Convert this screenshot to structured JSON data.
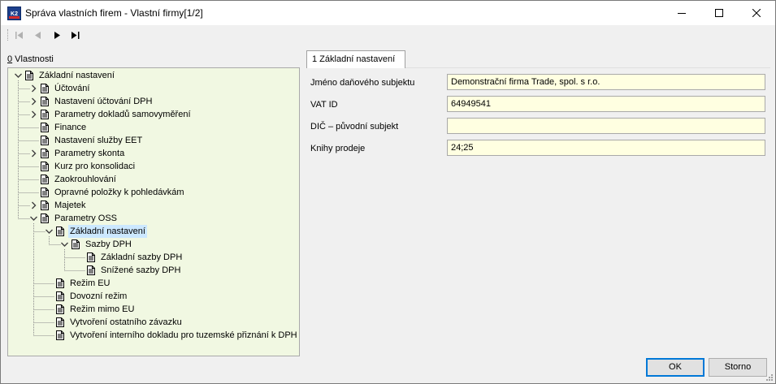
{
  "window": {
    "title": "Správa vlastních firem - Vlastní firmy[1/2]",
    "app_icon_text": "K2"
  },
  "toolbar": {
    "buttons": [
      "first-record",
      "previous-record",
      "next-record",
      "last-record"
    ]
  },
  "left_panel": {
    "label_hotkey": "0",
    "label_rest": " Vlastnosti"
  },
  "tree": {
    "items": [
      {
        "label": "Základní nastavení",
        "level": 0,
        "expander": "expanded",
        "selected": false
      },
      {
        "label": "Účtování",
        "level": 1,
        "expander": "collapsed",
        "selected": false
      },
      {
        "label": "Nastavení účtování DPH",
        "level": 1,
        "expander": "collapsed",
        "selected": false
      },
      {
        "label": "Parametry dokladů samovyměření",
        "level": 1,
        "expander": "collapsed",
        "selected": false
      },
      {
        "label": "Finance",
        "level": 1,
        "expander": "none",
        "selected": false
      },
      {
        "label": "Nastavení služby EET",
        "level": 1,
        "expander": "none",
        "selected": false
      },
      {
        "label": "Parametry skonta",
        "level": 1,
        "expander": "collapsed",
        "selected": false
      },
      {
        "label": "Kurz pro konsolidaci",
        "level": 1,
        "expander": "none",
        "selected": false
      },
      {
        "label": "Zaokrouhlování",
        "level": 1,
        "expander": "none",
        "selected": false
      },
      {
        "label": "Opravné položky k pohledávkám",
        "level": 1,
        "expander": "none",
        "selected": false
      },
      {
        "label": "Majetek",
        "level": 1,
        "expander": "collapsed",
        "selected": false
      },
      {
        "label": "Parametry OSS",
        "level": 1,
        "expander": "expanded",
        "selected": false
      },
      {
        "label": "Základní nastavení",
        "level": 2,
        "expander": "expanded",
        "selected": true
      },
      {
        "label": "Sazby DPH",
        "level": 3,
        "expander": "expanded",
        "selected": false
      },
      {
        "label": "Základní sazby DPH",
        "level": 4,
        "expander": "none",
        "selected": false
      },
      {
        "label": "Snížené sazby DPH",
        "level": 4,
        "expander": "none",
        "selected": false
      },
      {
        "label": "Režim EU",
        "level": 2,
        "expander": "none",
        "selected": false
      },
      {
        "label": "Dovozní režim",
        "level": 2,
        "expander": "none",
        "selected": false
      },
      {
        "label": "Režim mimo EU",
        "level": 2,
        "expander": "none",
        "selected": false
      },
      {
        "label": "Vytvoření ostatního závazku",
        "level": 2,
        "expander": "none",
        "selected": false
      },
      {
        "label": "Vytvoření interního dokladu pro tuzemské přiznání k DPH",
        "level": 2,
        "expander": "none",
        "selected": false
      }
    ]
  },
  "tab": {
    "label": "1 Základní nastavení"
  },
  "form": {
    "fields": [
      {
        "label": "Jméno daňového subjektu",
        "value": "Demonstrační firma Trade, spol. s r.o."
      },
      {
        "label": "VAT ID",
        "value": "64949541"
      },
      {
        "label": "DIČ – původní subjekt",
        "value": ""
      },
      {
        "label": "Knihy prodeje",
        "value": "24;25"
      }
    ]
  },
  "buttons": {
    "ok": "OK",
    "cancel": "Storno"
  },
  "colors": {
    "tree_background": "#f1f8e2",
    "input_background": "#ffffe1",
    "selection": "#cce8ff",
    "default_button_border": "#0078d7"
  }
}
